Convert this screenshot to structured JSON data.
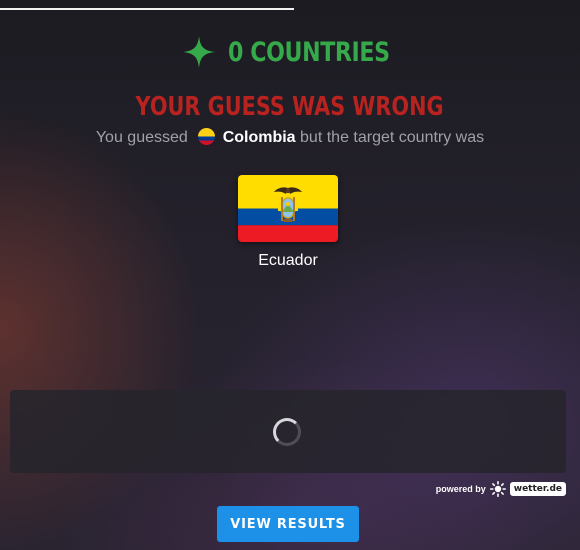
{
  "header": {
    "score_text": "0 COUNTRIES",
    "score_icon": "sparkle-icon",
    "score_color": "#36a94a"
  },
  "result": {
    "title": "YOUR GUESS WAS WRONG",
    "title_color": "#b8221f",
    "guess_prefix": "You guessed",
    "guessed_country": "Colombia",
    "guess_suffix": "but the target country was",
    "target_country": "Ecuador",
    "guessed_flag_icon": "colombia-flag-icon",
    "target_flag_icon": "ecuador-flag-icon"
  },
  "map": {
    "loading_icon": "loading-spinner-icon"
  },
  "attribution": {
    "prefix": "powered by",
    "brand": "wetter.de",
    "brand_icon": "sun-icon"
  },
  "actions": {
    "view_results_label": "VIEW RESULTS",
    "button_color": "#1d90e8"
  }
}
